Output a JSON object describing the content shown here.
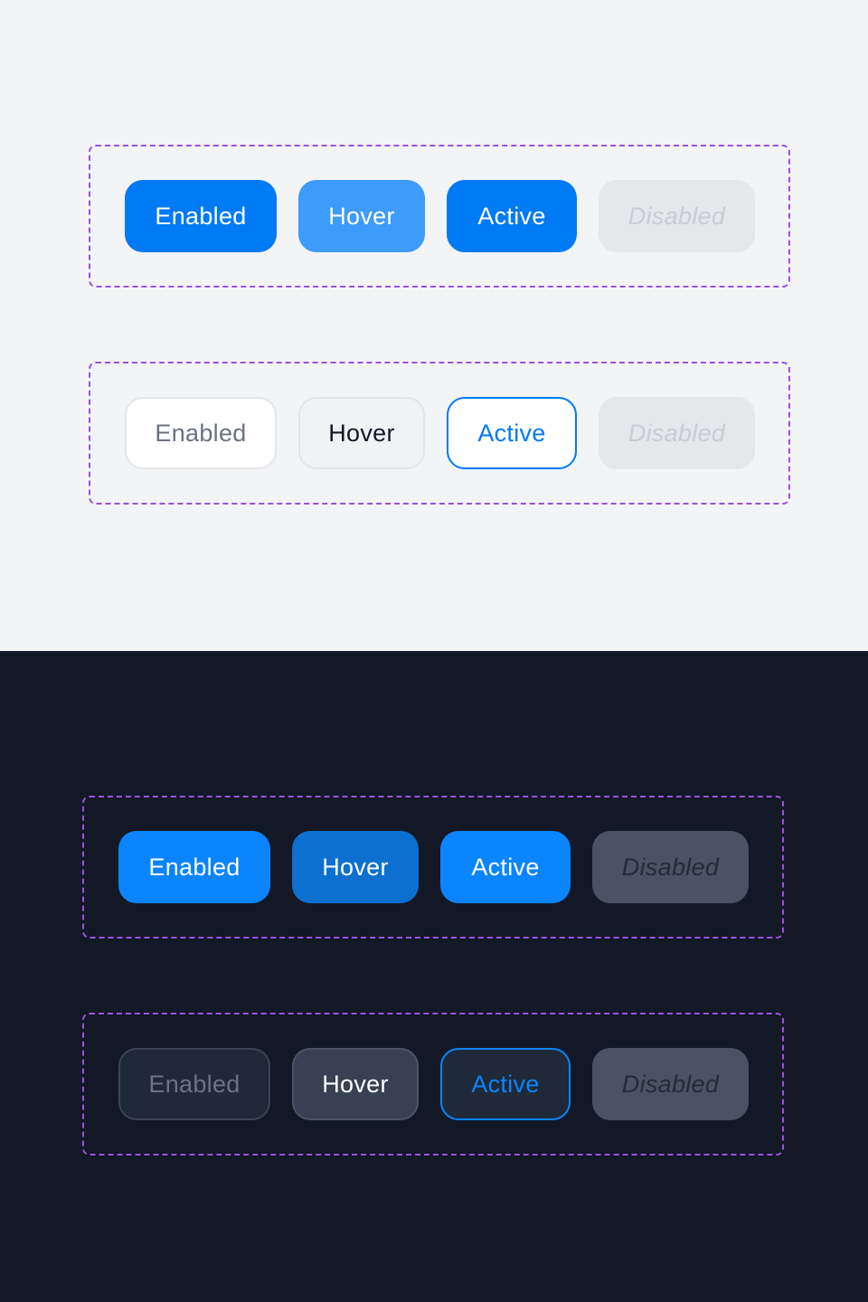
{
  "themes": {
    "light": {
      "primary": {
        "enabled": "Enabled",
        "hover": "Hover",
        "active": "Active",
        "disabled": "Disabled"
      },
      "secondary": {
        "enabled": "Enabled",
        "hover": "Hover",
        "active": "Active",
        "disabled": "Disabled"
      }
    },
    "dark": {
      "primary": {
        "enabled": "Enabled",
        "hover": "Hover",
        "active": "Active",
        "disabled": "Disabled"
      },
      "secondary": {
        "enabled": "Enabled",
        "hover": "Hover",
        "active": "Active",
        "disabled": "Disabled"
      }
    }
  },
  "colors": {
    "accent_light": "#007af5",
    "accent_dark": "#0a84ff",
    "group_outline": "#9b51e0",
    "light_background": "#f3f4f6",
    "dark_background": "#121826"
  }
}
